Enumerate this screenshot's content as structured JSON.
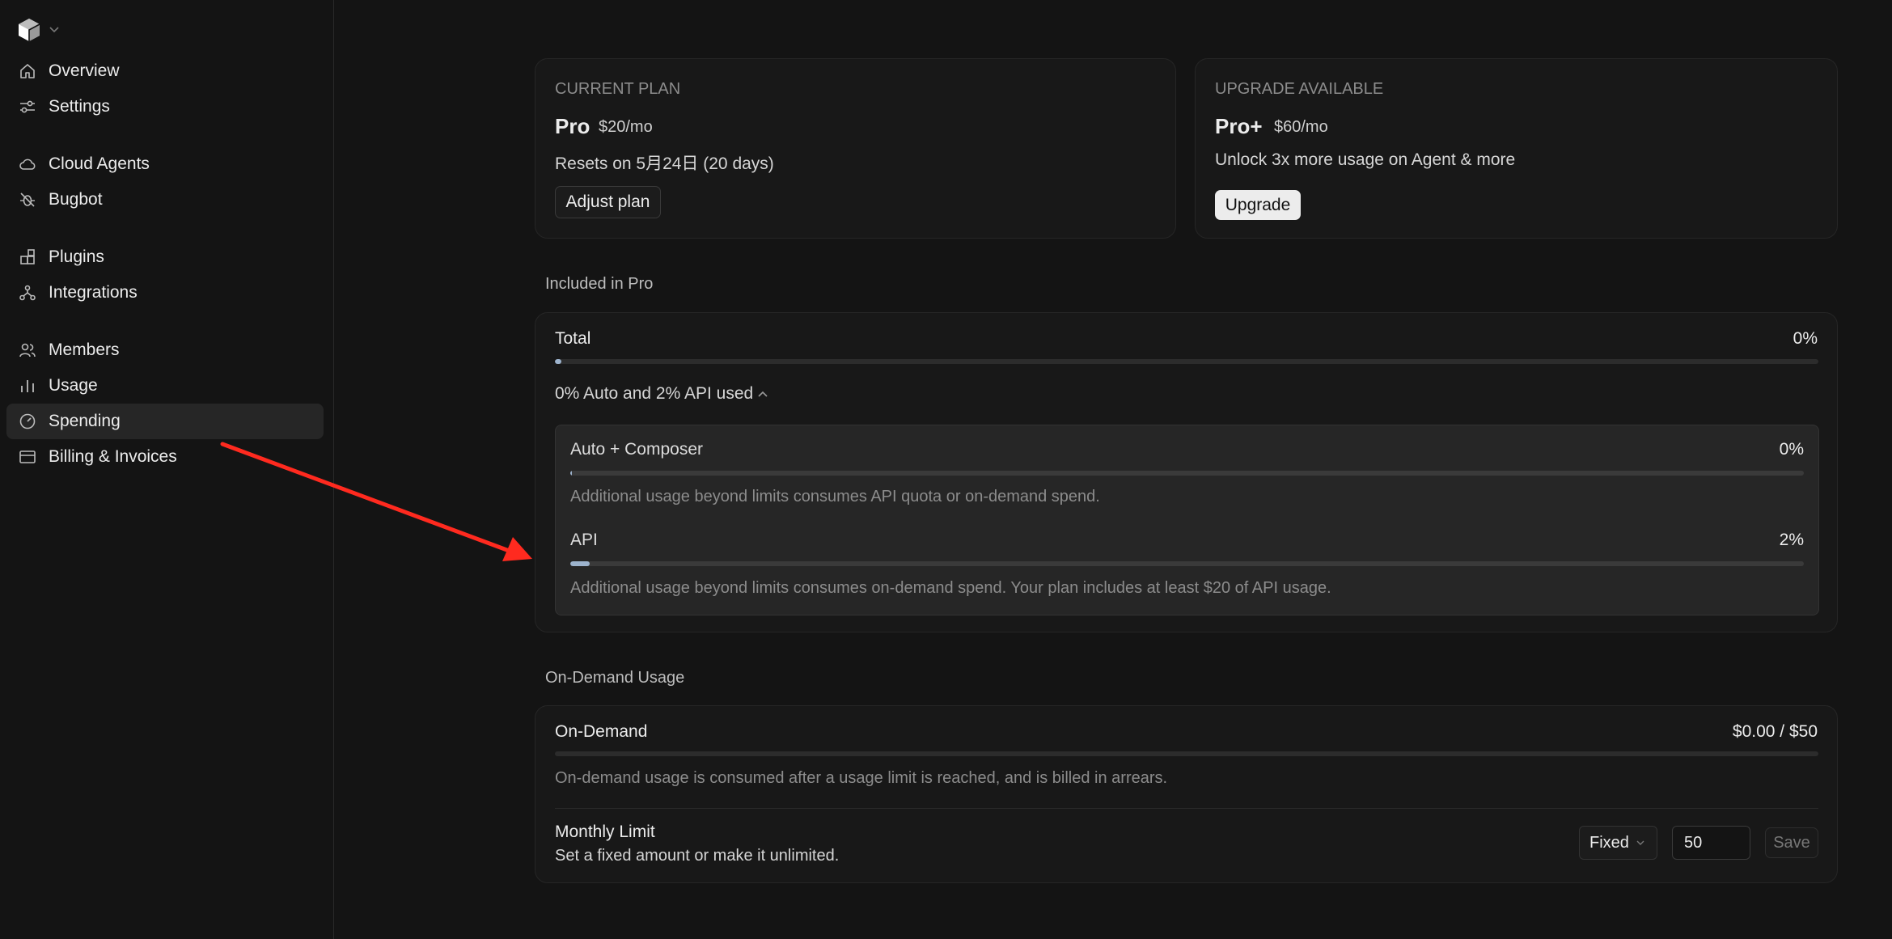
{
  "sidebar": {
    "items": [
      {
        "label": "Overview",
        "icon": "home-icon"
      },
      {
        "label": "Settings",
        "icon": "sliders-icon"
      },
      {
        "label": "Cloud Agents",
        "icon": "cloud-icon"
      },
      {
        "label": "Bugbot",
        "icon": "bug-icon"
      },
      {
        "label": "Plugins",
        "icon": "plugin-icon"
      },
      {
        "label": "Integrations",
        "icon": "integrations-icon"
      },
      {
        "label": "Members",
        "icon": "members-icon"
      },
      {
        "label": "Usage",
        "icon": "bar-chart-icon"
      },
      {
        "label": "Spending",
        "icon": "gauge-icon",
        "active": true
      },
      {
        "label": "Billing & Invoices",
        "icon": "card-icon"
      }
    ]
  },
  "current_plan": {
    "heading": "CURRENT PLAN",
    "name": "Pro",
    "price": "$20/mo",
    "resets": "Resets on 5月24日 (20 days)",
    "button": "Adjust plan"
  },
  "upgrade": {
    "heading": "UPGRADE AVAILABLE",
    "name": "Pro+",
    "price": "$60/mo",
    "desc": "Unlock 3x more usage on Agent & more",
    "button": "Upgrade"
  },
  "included": {
    "section_title": "Included in Pro",
    "total_label": "Total",
    "total_value": "0%",
    "total_progress": 0.005,
    "toggle_text": "0% Auto and 2% API used",
    "auto": {
      "label": "Auto + Composer",
      "value": "0%",
      "progress": 0.001,
      "note": "Additional usage beyond limits consumes API quota or on-demand spend."
    },
    "api": {
      "label": "API",
      "value": "2%",
      "progress": 0.016,
      "note": "Additional usage beyond limits consumes on-demand spend. Your plan includes at least $20 of API usage."
    }
  },
  "on_demand": {
    "section_title": "On-Demand Usage",
    "label": "On-Demand",
    "value": "$0.00 / $50",
    "progress": 0,
    "note": "On-demand usage is consumed after a usage limit is reached, and is billed in arrears.",
    "limit_title": "Monthly Limit",
    "limit_desc": "Set a fixed amount or make it unlimited.",
    "mode": "Fixed",
    "amount": "50",
    "save": "Save"
  },
  "colors": {
    "accent_bar": "#9db3cd",
    "annotation_arrow": "#ff2a1f"
  }
}
